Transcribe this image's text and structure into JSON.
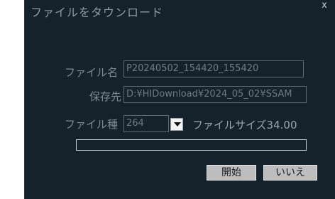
{
  "window": {
    "title": "ファイルをタウンロード",
    "close_label": "x"
  },
  "form": {
    "filename_label": "ファイル名",
    "filename_value": "P20240502_154420_155420",
    "save_label": "保存先",
    "save_value": "D:¥HIDownload¥2024_05_02¥SSAM",
    "filetype_label": "ファイル種",
    "filetype_value": "264",
    "filesize_text": "ファイルサイズ34.00"
  },
  "progress": {
    "value": 0
  },
  "buttons": {
    "start": "開始",
    "no": "いいえ"
  }
}
